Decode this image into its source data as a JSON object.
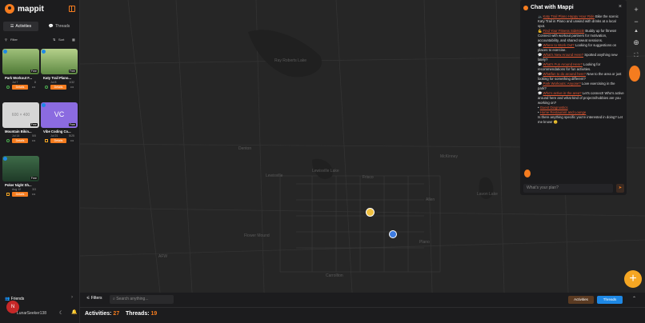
{
  "app": {
    "name": "mappit"
  },
  "sidebar": {
    "tabs": [
      {
        "label": "Activities"
      },
      {
        "label": "Threads"
      }
    ],
    "filter_label": "Filter",
    "sort_label": "Sort",
    "cards": [
      {
        "title": "Park Workout F...",
        "date": "Jul 7",
        "count": "8",
        "price": "Free",
        "details": "Details",
        "thumb_color": "#6a8f4a"
      },
      {
        "title": "Katy Trail Plano...",
        "date": "Jul 8",
        "count": "1/32",
        "price": "Free",
        "details": "Details",
        "thumb_color": "#7a9a5a"
      },
      {
        "title": "Mountain Bikin...",
        "date": "Jul 14",
        "count": "5/5",
        "price": "Free",
        "details": "Details",
        "thumb_color": "#d8d8d8",
        "thumb_text": "600 × 400"
      },
      {
        "title": "Vibe Coding Co...",
        "date": "Jul 21",
        "count": "5/25",
        "price": "Free",
        "details": "Details",
        "thumb_color": "#8b6be0",
        "thumb_text": "VC"
      },
      {
        "title": "Poker Night Sh...",
        "date": "Aug 12",
        "count": "3/3",
        "price": "Free",
        "details": "Details",
        "thumb_color": "#2f5a3a"
      }
    ],
    "friends_label": "Friends",
    "avatar_letter": "N",
    "username": "LunarSeeker138"
  },
  "map": {
    "places": [
      {
        "name": "Ray Roberts Lake"
      },
      {
        "name": "Denton"
      },
      {
        "name": "Frisco"
      },
      {
        "name": "McKinney"
      },
      {
        "name": "Carrollton"
      },
      {
        "name": "Plano"
      },
      {
        "name": "Allen"
      },
      {
        "name": "Lavon Lake"
      },
      {
        "name": "Flower Mound"
      },
      {
        "name": "Lewisville Lake"
      },
      {
        "name": "Lewisville"
      },
      {
        "name": "AFW"
      }
    ]
  },
  "chat": {
    "title": "Chat with Mappi",
    "lines": [
      {
        "link": "Katy Trail Plano Happy Hour Ride",
        "text": " Bike the scenic Katy Trail in Plano and unwind with drinks at a local spot."
      },
      {
        "link": "Find Your Fitness Sidekick!",
        "text": " Buddy up for fitness! Connect with workout partners for motivation, accountability, and shared sweat sessions."
      },
      {
        "link": "Where to Work Out?",
        "text": " Looking for suggestions on places to exercise."
      },
      {
        "link": "What's New Around Here?",
        "text": " Spotted anything new lately?"
      },
      {
        "link": "What's Fun Around Here?",
        "text": " Looking for recommendations for fun activities."
      },
      {
        "link": "Whatfun to do around here?",
        "text": " New to the area or just looking for something different?"
      },
      {
        "link": "Park Workouts: Anyone?",
        "text": " Love exercising in the park?"
      },
      {
        "link": "Who's active in the area?",
        "text": " Let's connect! Who's active around here and what kind of projects/hobbies are you working on?"
      },
      {
        "link": "Guest Diagnostics",
        "text": ""
      },
      {
        "link": "Home Restaurant and Lounge",
        "text": ""
      }
    ],
    "closing": "Is there anything specific you're interested in doing? Let me know! 😊",
    "input_placeholder": "What's your plan?"
  },
  "bottom": {
    "filters_label": "Filters",
    "search_placeholder": "Search anything...",
    "activities_btn": "Activities",
    "threads_btn": "Threads",
    "activities_label": "Activities:",
    "activities_count": "27",
    "threads_label": "Threads:",
    "threads_count": "19"
  }
}
